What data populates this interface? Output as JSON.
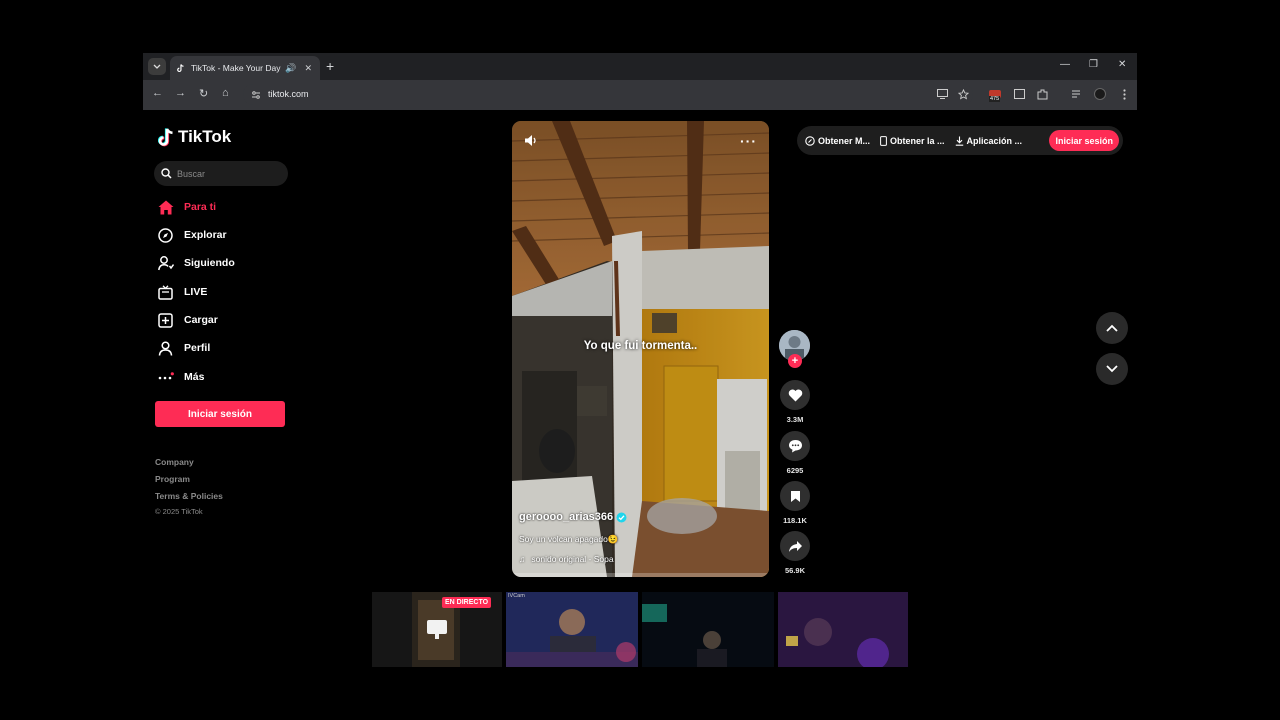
{
  "browser": {
    "tab_title": "TikTok - Make Your Day",
    "url": "tiktok.com",
    "extension_badge": "475"
  },
  "sidebar": {
    "logo": "TikTok",
    "search_placeholder": "Buscar",
    "items": [
      {
        "label": "Para ti",
        "icon": "home-icon",
        "active": true
      },
      {
        "label": "Explorar",
        "icon": "compass-icon",
        "active": false
      },
      {
        "label": "Siguiendo",
        "icon": "user-follow-icon",
        "active": false
      },
      {
        "label": "LIVE",
        "icon": "live-tv-icon",
        "active": false
      },
      {
        "label": "Cargar",
        "icon": "upload-plus-icon",
        "active": false
      },
      {
        "label": "Perfil",
        "icon": "profile-icon",
        "active": false
      },
      {
        "label": "Más",
        "icon": "more-dots-icon",
        "active": false
      }
    ],
    "login_label": "Iniciar sesión",
    "footer": {
      "company": "Company",
      "program": "Program",
      "terms": "Terms & Policies",
      "copyright": "© 2025 TikTok"
    }
  },
  "video": {
    "caption_overlay": "Yo que fui tormenta..",
    "username": "geroooo_arias366",
    "description": "Soy un volcan apagado😉",
    "sound": "sonido original - Sopa"
  },
  "actions": {
    "likes": "3.3M",
    "comments": "6295",
    "saves": "118.1K",
    "shares": "56.9K"
  },
  "topbar": {
    "link1": "Obtener M...",
    "link2": "Obtener la ...",
    "link3": "Aplicación ...",
    "login_label": "Iniciar sesión"
  },
  "live_strip": {
    "badge": "EN DIRECTO",
    "label2": "IVCam"
  },
  "colors": {
    "accent": "#fe2c55",
    "background": "#000000"
  }
}
